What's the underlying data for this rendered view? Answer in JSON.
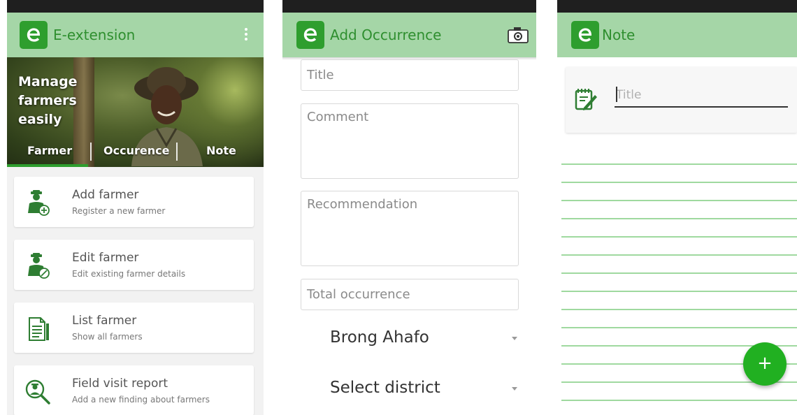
{
  "screen_main": {
    "app_title": "E-extension",
    "hero_lines": [
      "Manage",
      "farmers",
      "easily"
    ],
    "tabs": [
      {
        "label": "Farmer"
      },
      {
        "label": "Occurence"
      },
      {
        "label": "Note"
      }
    ],
    "active_tab": "Farmer",
    "items": [
      {
        "title": "Add farmer",
        "subtitle": "Register a new farmer",
        "icon": "add-farmer-icon"
      },
      {
        "title": "Edit farmer",
        "subtitle": "Edit existing farmer details",
        "icon": "edit-farmer-icon"
      },
      {
        "title": "List farmer",
        "subtitle": "Show all farmers",
        "icon": "list-document-icon"
      },
      {
        "title": "Field visit report",
        "subtitle": "Add a new finding about farmers",
        "icon": "search-farmer-icon"
      }
    ]
  },
  "screen_occurrence": {
    "app_title": "Add Occurrence",
    "fields": {
      "title_placeholder": "Title",
      "comment_placeholder": "Comment",
      "recommendation_placeholder": "Recommendation",
      "total_placeholder": "Total occurrence"
    },
    "region_value": "Brong Ahafo",
    "district_value": "Select district"
  },
  "screen_note": {
    "app_title": "Note",
    "title_placeholder": "Title",
    "fab_label": "+"
  },
  "colors": {
    "appbar": "#a5d6a7",
    "brand_green": "#2e9e2e",
    "fab_green": "#21b021",
    "ruled_line": "#9fd99f"
  }
}
